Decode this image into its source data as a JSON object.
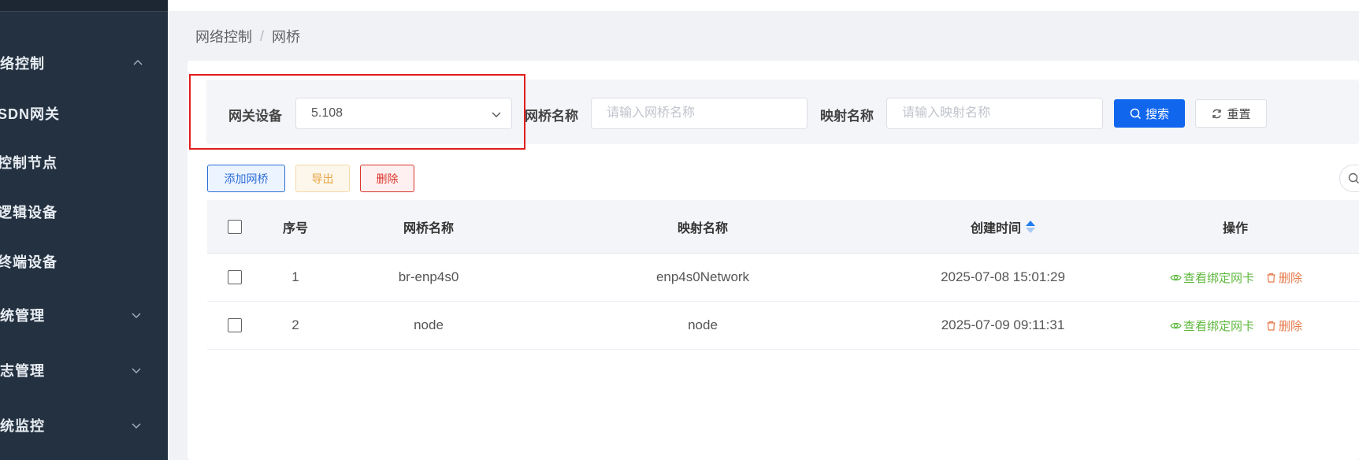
{
  "sidebar": {
    "items": [
      {
        "label": "络控制",
        "expanded": true
      },
      {
        "label": "SDN网关"
      },
      {
        "label": "控制节点"
      },
      {
        "label": "逻辑设备"
      },
      {
        "label": "终端设备"
      },
      {
        "label": "统管理",
        "expanded": false
      },
      {
        "label": "志管理",
        "expanded": false
      },
      {
        "label": "统监控",
        "expanded": false
      }
    ]
  },
  "breadcrumb": {
    "parent": "网络控制",
    "separator": "/",
    "current": "网桥"
  },
  "filters": {
    "gateway_label": "网关设备",
    "gateway_value": "5.108",
    "bridge_name_label": "网桥名称",
    "bridge_name_placeholder": "请输入网桥名称",
    "mapping_name_label": "映射名称",
    "mapping_name_placeholder": "请输入映射名称",
    "search_button": "搜索",
    "reset_button": "重置"
  },
  "actions": {
    "add_label": "添加网桥",
    "export_label": "导出",
    "delete_label": "删除"
  },
  "table": {
    "columns": {
      "index": "序号",
      "bridge_name": "网桥名称",
      "mapping_name": "映射名称",
      "created_time": "创建时间",
      "operations": "操作"
    },
    "rows": [
      {
        "index": "1",
        "bridge_name": "br-enp4s0",
        "mapping_name": "enp4s0Network",
        "created_time": "2025-07-08 15:01:29",
        "view_label": "查看绑定网卡",
        "delete_label": "删除"
      },
      {
        "index": "2",
        "bridge_name": "node",
        "mapping_name": "node",
        "created_time": "2025-07-09 09:11:31",
        "view_label": "查看绑定网卡",
        "delete_label": "删除"
      }
    ]
  },
  "colors": {
    "sidebar_bg": "#243140",
    "primary": "#1166ee",
    "danger": "#d9342b",
    "warning": "#e6a23c",
    "success": "#5fb93f",
    "highlight_box": "#e01e1e"
  }
}
